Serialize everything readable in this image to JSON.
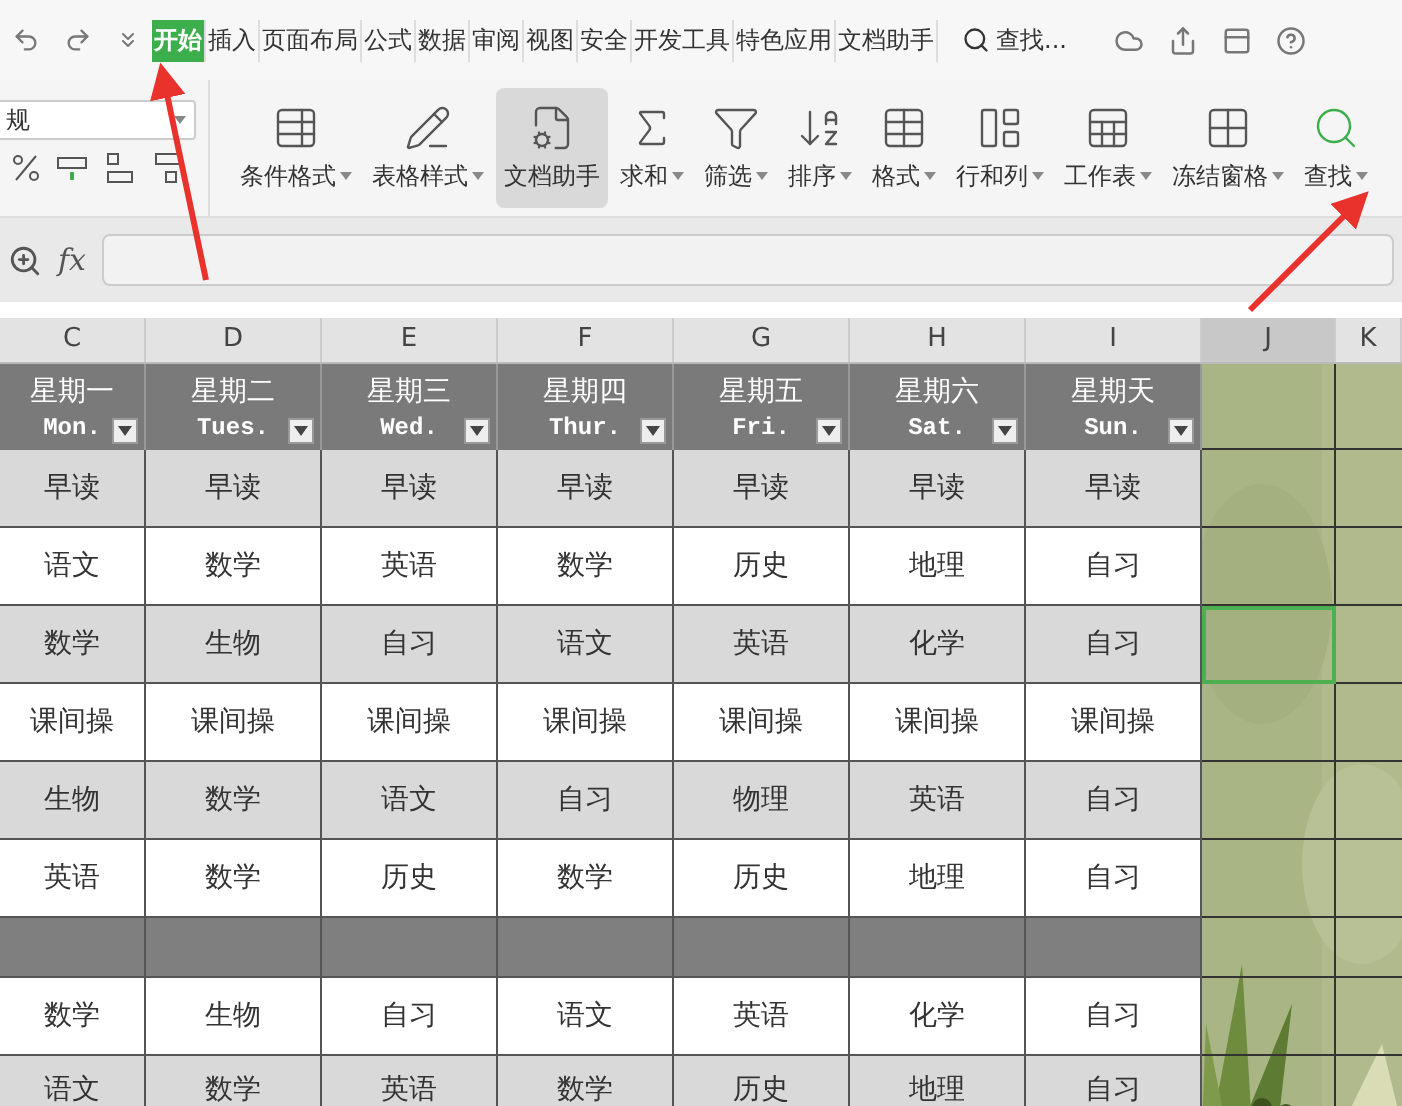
{
  "menu_tabs": [
    {
      "label": "开始",
      "selected": true
    },
    {
      "label": "插入",
      "selected": false
    },
    {
      "label": "页面布局",
      "selected": false
    },
    {
      "label": "公式",
      "selected": false
    },
    {
      "label": "数据",
      "selected": false
    },
    {
      "label": "审阅",
      "selected": false
    },
    {
      "label": "视图",
      "selected": false
    },
    {
      "label": "安全",
      "selected": false
    },
    {
      "label": "开发工具",
      "selected": false
    },
    {
      "label": "特色应用",
      "selected": false
    },
    {
      "label": "文档助手",
      "selected": false
    }
  ],
  "search_label": "查找...",
  "number_format": "规",
  "ribbon_buttons": [
    {
      "label": "条件格式",
      "dropdown": true,
      "selected": false
    },
    {
      "label": "表格样式",
      "dropdown": true,
      "selected": false
    },
    {
      "label": "文档助手",
      "dropdown": false,
      "selected": true
    },
    {
      "label": "求和",
      "dropdown": true,
      "selected": false
    },
    {
      "label": "筛选",
      "dropdown": true,
      "selected": false
    },
    {
      "label": "排序",
      "dropdown": true,
      "selected": false
    },
    {
      "label": "格式",
      "dropdown": true,
      "selected": false
    },
    {
      "label": "行和列",
      "dropdown": true,
      "selected": false
    },
    {
      "label": "工作表",
      "dropdown": true,
      "selected": false
    },
    {
      "label": "冻结窗格",
      "dropdown": true,
      "selected": false
    },
    {
      "label": "查找",
      "dropdown": true,
      "selected": false
    }
  ],
  "formula_label": "fx",
  "columns": [
    {
      "label": "C",
      "selected": false
    },
    {
      "label": "D",
      "selected": false
    },
    {
      "label": "E",
      "selected": false
    },
    {
      "label": "F",
      "selected": false
    },
    {
      "label": "G",
      "selected": false
    },
    {
      "label": "H",
      "selected": false
    },
    {
      "label": "I",
      "selected": false
    },
    {
      "label": "J",
      "selected": true
    },
    {
      "label": "K",
      "selected": false
    }
  ],
  "days": [
    {
      "name": "星期一",
      "abbr": "Mon."
    },
    {
      "name": "星期二",
      "abbr": "Tues."
    },
    {
      "name": "星期三",
      "abbr": "Wed."
    },
    {
      "name": "星期四",
      "abbr": "Thur."
    },
    {
      "name": "星期五",
      "abbr": "Fri."
    },
    {
      "name": "星期六",
      "abbr": "Sat."
    },
    {
      "name": "星期天",
      "abbr": "Sun."
    }
  ],
  "rows": [
    {
      "kind": "gray",
      "j_selected": false,
      "cells": [
        "早读",
        "早读",
        "早读",
        "早读",
        "早读",
        "早读",
        "早读"
      ]
    },
    {
      "kind": "white",
      "j_selected": false,
      "cells": [
        "语文",
        "数学",
        "英语",
        "数学",
        "历史",
        "地理",
        "自习"
      ]
    },
    {
      "kind": "gray",
      "j_selected": true,
      "cells": [
        "数学",
        "生物",
        "自习",
        "语文",
        "英语",
        "化学",
        "自习"
      ]
    },
    {
      "kind": "white",
      "j_selected": false,
      "cells": [
        "课间操",
        "课间操",
        "课间操",
        "课间操",
        "课间操",
        "课间操",
        "课间操"
      ]
    },
    {
      "kind": "gray",
      "j_selected": false,
      "cells": [
        "生物",
        "数学",
        "语文",
        "自习",
        "物理",
        "英语",
        "自习"
      ]
    },
    {
      "kind": "white",
      "j_selected": false,
      "cells": [
        "英语",
        "数学",
        "历史",
        "数学",
        "历史",
        "地理",
        "自习"
      ]
    },
    {
      "kind": "divider",
      "j_selected": false,
      "cells": []
    },
    {
      "kind": "white",
      "j_selected": false,
      "cells": [
        "数学",
        "生物",
        "自习",
        "语文",
        "英语",
        "化学",
        "自习"
      ]
    },
    {
      "kind": "partial",
      "j_selected": false,
      "cells": [
        "语文",
        "数学",
        "英语",
        "数学",
        "历史",
        "地理",
        "自习"
      ]
    }
  ]
}
